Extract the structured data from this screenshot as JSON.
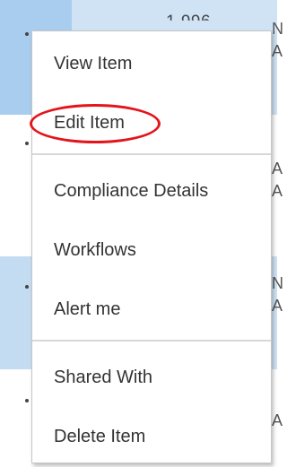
{
  "background_list": {
    "row_number_partial": "1,996",
    "edge_letters": [
      "N",
      "A",
      "A",
      "A",
      "N",
      "A",
      "A"
    ]
  },
  "context_menu": {
    "items": [
      {
        "label": "View Item"
      },
      {
        "label": "Edit Item"
      },
      {
        "label": "Compliance Details"
      },
      {
        "label": "Workflows"
      },
      {
        "label": "Alert me"
      },
      {
        "label": "Shared With"
      },
      {
        "label": "Delete Item"
      }
    ]
  },
  "annotation": {
    "shape": "oval",
    "color": "#e4141b",
    "highlights": "Edit Item"
  }
}
